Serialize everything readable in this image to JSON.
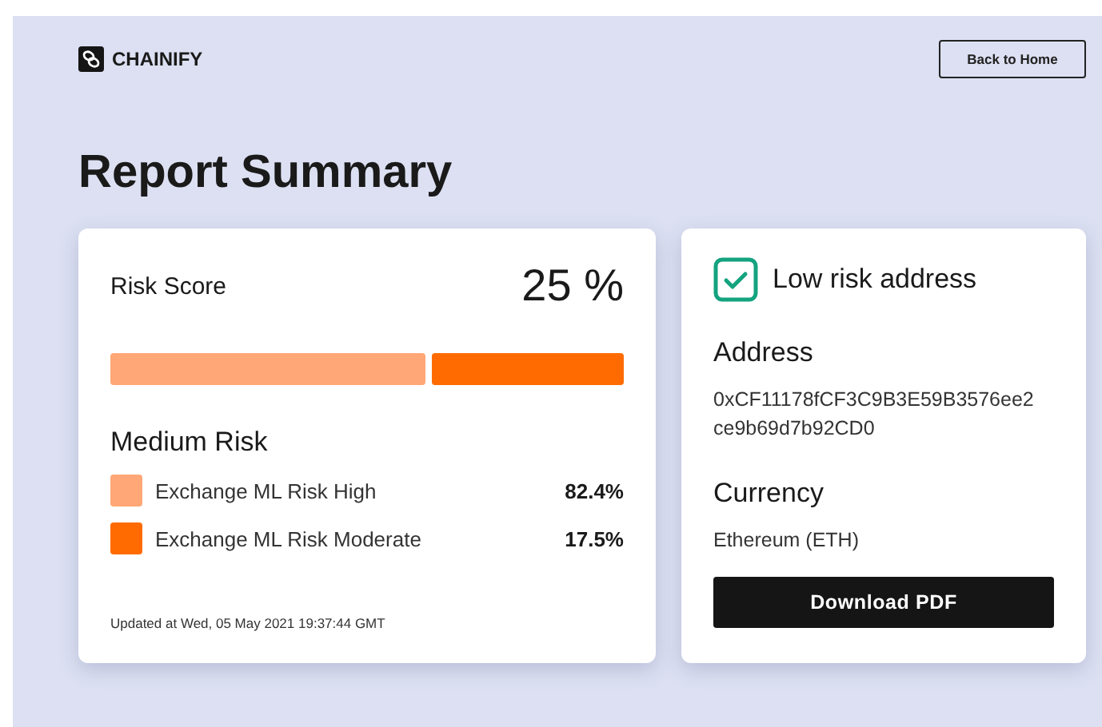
{
  "brand": {
    "name": "CHAINIFY"
  },
  "header": {
    "back_button": "Back to Home"
  },
  "title": "Report Summary",
  "risk_card": {
    "label": "Risk Score",
    "score": "25 %",
    "bar": [
      {
        "color": "#ffa776"
      },
      {
        "color": "#ff6b00"
      }
    ],
    "category": "Medium Risk",
    "items": [
      {
        "label": "Exchange ML Risk High",
        "value": "82.4%",
        "color": "#ffa776"
      },
      {
        "label": "Exchange ML Risk Moderate",
        "value": "17.5%",
        "color": "#ff6b00"
      }
    ],
    "updated": "Updated at Wed, 05 May 2021 19:37:44 GMT"
  },
  "address_card": {
    "status": "Low risk address",
    "checked": true,
    "address_label": "Address",
    "address": "0xCF11178fCF3C9B3E59B3576ee2ce9b69d7b92CD0",
    "currency_label": "Currency",
    "currency": "Ethereum (ETH)",
    "download_button": "Download PDF"
  }
}
